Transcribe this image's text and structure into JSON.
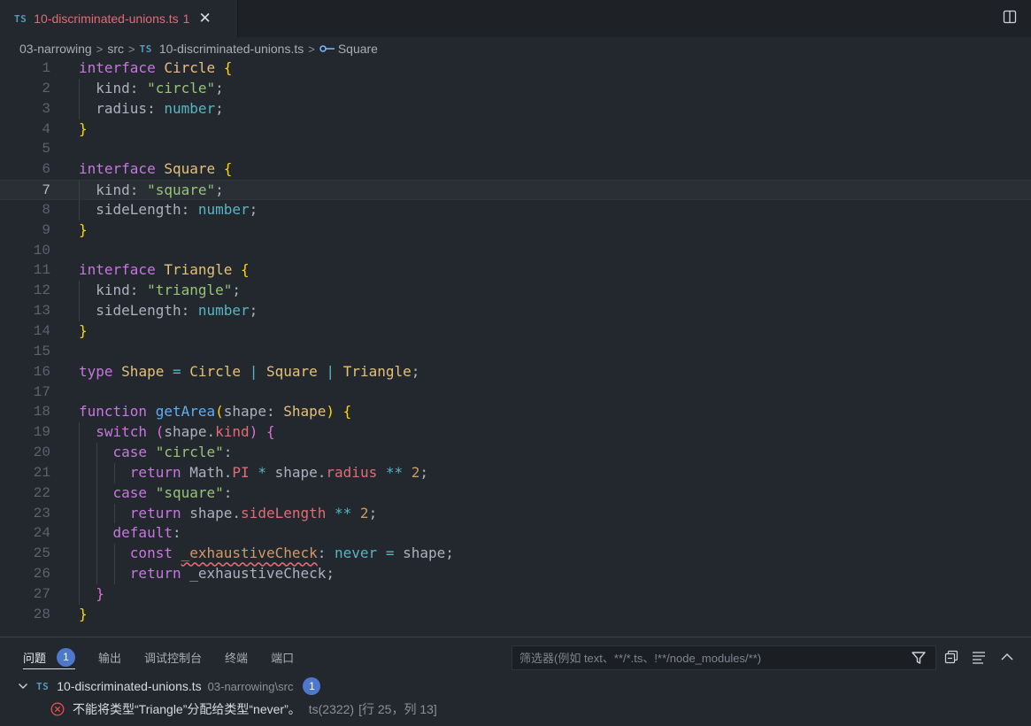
{
  "tab": {
    "icon": "TS",
    "title": "10-discriminated-unions.ts",
    "problem_count": "1",
    "close": "✕"
  },
  "breadcrumb": {
    "folder": "03-narrowing",
    "sub": "src",
    "icon": "TS",
    "file": "10-discriminated-unions.ts",
    "symbol": "Square"
  },
  "editor": {
    "current_line": 7,
    "line_numbers": [
      "1",
      "2",
      "3",
      "4",
      "5",
      "6",
      "7",
      "8",
      "9",
      "10",
      "11",
      "12",
      "13",
      "14",
      "15",
      "16",
      "17",
      "18",
      "19",
      "20",
      "21",
      "22",
      "23",
      "24",
      "25",
      "26",
      "27",
      "28"
    ],
    "code": {
      "l1": [
        "interface",
        "Circle",
        "{"
      ],
      "l2": [
        "kind",
        ": ",
        "\"circle\"",
        ";"
      ],
      "l3": [
        "radius",
        ": ",
        "number",
        ";"
      ],
      "l4": [
        "}"
      ],
      "l6": [
        "interface",
        "Square",
        "{"
      ],
      "l7": [
        "kind",
        ": ",
        "\"square\"",
        ";"
      ],
      "l8": [
        "sideLength",
        ": ",
        "number",
        ";"
      ],
      "l9": [
        "}"
      ],
      "l11": [
        "interface",
        "Triangle",
        "{"
      ],
      "l12": [
        "kind",
        ": ",
        "\"triangle\"",
        ";"
      ],
      "l13": [
        "sideLength",
        ": ",
        "number",
        ";"
      ],
      "l14": [
        "}"
      ],
      "l16": [
        "type",
        "Shape",
        "=",
        "Circle",
        "|",
        "Square",
        "|",
        "Triangle",
        ";"
      ],
      "l18": [
        "function",
        "getArea",
        "(",
        "shape",
        ": ",
        "Shape",
        ")",
        "{"
      ],
      "l19": [
        "switch",
        "(",
        "shape",
        ".",
        "kind",
        ")",
        "{"
      ],
      "l20": [
        "case",
        "\"circle\"",
        ":"
      ],
      "l21": [
        "return",
        "Math",
        ".",
        "PI",
        "*",
        "shape",
        ".",
        "radius",
        "**",
        "2",
        ";"
      ],
      "l22": [
        "case",
        "\"square\"",
        ":"
      ],
      "l23": [
        "return",
        "shape",
        ".",
        "sideLength",
        "**",
        "2",
        ";"
      ],
      "l24": [
        "default",
        ":"
      ],
      "l25": [
        "const",
        "_exhaustiveCheck",
        ": ",
        "never",
        "=",
        "shape",
        ";"
      ],
      "l26": [
        "return",
        "_exhaustiveCheck",
        ";"
      ],
      "l27": [
        "}"
      ],
      "l28": [
        "}"
      ]
    }
  },
  "panel": {
    "tabs": [
      "问题",
      "输出",
      "调试控制台",
      "终端",
      "端口"
    ],
    "problems_badge": "1",
    "filter_placeholder": "筛选器(例如 text、**/*.ts、!**/node_modules/**)",
    "icons": [
      "filter-icon",
      "collapse-all-icon",
      "view-as-list-icon",
      "maximize-panel-icon"
    ],
    "group": {
      "icon": "TS",
      "file": "10-discriminated-unions.ts",
      "path": "03-narrowing\\src",
      "count": "1"
    },
    "problem": {
      "message": "不能将类型“Triangle”分配给类型“never”。",
      "code": "ts(2322)",
      "position": "[行 25，列 13]"
    }
  },
  "colors": {
    "background": "#23272e",
    "keyword": "#c678dd",
    "type": "#e5c07b",
    "string": "#98c379",
    "builtin_type": "#56b6c2",
    "function": "#61afef",
    "property": "#e06c75",
    "number": "#d19a66",
    "badge": "#4d78cc",
    "error": "#e06c75"
  }
}
